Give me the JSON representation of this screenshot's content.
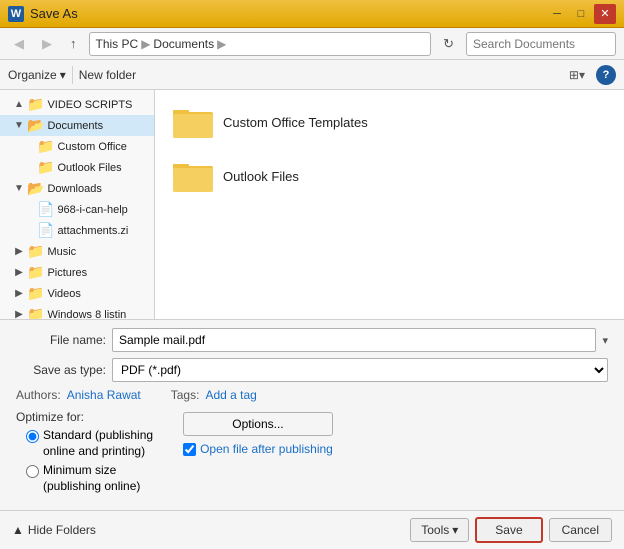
{
  "titleBar": {
    "title": "Save As",
    "wordIconLabel": "W"
  },
  "toolbar": {
    "backBtn": "◀",
    "forwardBtn": "▶",
    "upBtn": "▲",
    "breadcrumb": {
      "thisPc": "This PC",
      "documents": "Documents"
    },
    "searchPlaceholder": "Search Documents",
    "searchIcon": "🔍"
  },
  "secondToolbar": {
    "organizeLabel": "Organize",
    "newFolderLabel": "New folder",
    "viewIcon": "⊞",
    "helpLabel": "?"
  },
  "sidebar": {
    "items": [
      {
        "label": "VIDEO SCRIPTS",
        "indent": 0,
        "arrow": "▲",
        "icon": "folder",
        "type": "closed"
      },
      {
        "label": "Documents",
        "indent": 1,
        "arrow": "▼",
        "icon": "folder",
        "type": "open",
        "selected": true
      },
      {
        "label": "Custom Office",
        "indent": 2,
        "arrow": "",
        "icon": "folder",
        "type": "closed"
      },
      {
        "label": "Outlook Files",
        "indent": 2,
        "arrow": "",
        "icon": "folder",
        "type": "closed"
      },
      {
        "label": "Downloads",
        "indent": 1,
        "arrow": "▼",
        "icon": "folder",
        "type": "open"
      },
      {
        "label": "968-i-can-help",
        "indent": 2,
        "arrow": "",
        "icon": "file",
        "type": "closed"
      },
      {
        "label": "attachments.zi",
        "indent": 2,
        "arrow": "",
        "icon": "file",
        "type": "closed"
      },
      {
        "label": "Music",
        "indent": 1,
        "arrow": "▶",
        "icon": "folder",
        "type": "closed"
      },
      {
        "label": "Pictures",
        "indent": 1,
        "arrow": "▶",
        "icon": "folder",
        "type": "closed"
      },
      {
        "label": "Videos",
        "indent": 1,
        "arrow": "▶",
        "icon": "folder",
        "type": "closed"
      },
      {
        "label": "Windows 8 listin",
        "indent": 1,
        "arrow": "▶",
        "icon": "folder",
        "type": "closed"
      }
    ]
  },
  "fileArea": {
    "items": [
      {
        "name": "Custom Office Templates"
      },
      {
        "name": "Outlook Files"
      }
    ]
  },
  "form": {
    "fileNameLabel": "File name:",
    "fileNameValue": "Sample mail.pdf",
    "saveAsTypeLabel": "Save as type:",
    "saveAsTypeValue": "PDF (*.pdf)"
  },
  "meta": {
    "authorsLabel": "Authors:",
    "authorsValue": "Anisha Rawat",
    "tagsLabel": "Tags:",
    "tagsValue": "Add a tag"
  },
  "optimize": {
    "label": "Optimize for:",
    "options": [
      {
        "id": "standard",
        "label": "Standard (publishing\nonline and printing)",
        "checked": true
      },
      {
        "id": "minimum",
        "label": "Minimum size\n(publishing online)",
        "checked": false
      }
    ]
  },
  "rightOptions": {
    "optionsBtnLabel": "Options...",
    "checkboxLabel": "Open file after publishing",
    "checkboxChecked": true
  },
  "footer": {
    "hideFoldersLabel": "Hide Folders",
    "hideIcon": "▲",
    "toolsLabel": "Tools",
    "toolsArrow": "▾",
    "saveLabel": "Save",
    "cancelLabel": "Cancel"
  }
}
